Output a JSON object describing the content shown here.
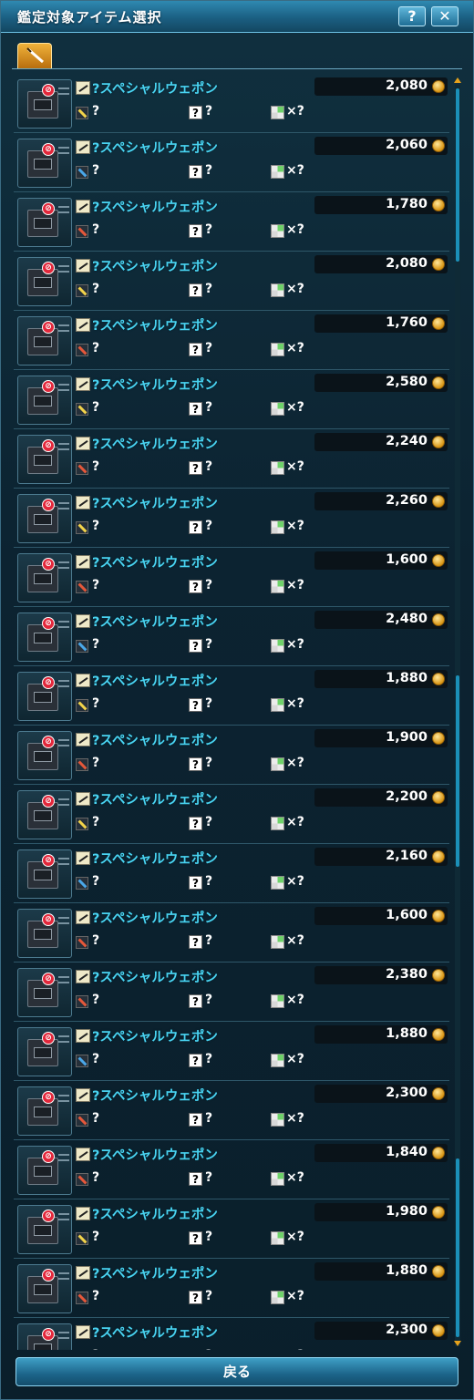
{
  "window": {
    "title": "鑑定対象アイテム選択",
    "help_label": "?",
    "close_label": "✕"
  },
  "icons": {
    "tab": "sword-icon",
    "row_thumb": "box-icon",
    "restricted": "ban-icon",
    "weapon": "weapon-icon",
    "category": "weapon-category-icon",
    "unknown": "question-icon",
    "lock": "lock-icon",
    "currency": "meseta-coin-icon"
  },
  "items": [
    {
      "name": "?スペシャルウェポン",
      "price": "2,080",
      "attr": "?",
      "unknown": "?",
      "multiplier": "×?"
    },
    {
      "name": "?スペシャルウェポン",
      "price": "2,060",
      "attr": "?",
      "unknown": "?",
      "multiplier": "×?"
    },
    {
      "name": "?スペシャルウェポン",
      "price": "1,780",
      "attr": "?",
      "unknown": "?",
      "multiplier": "×?"
    },
    {
      "name": "?スペシャルウェポン",
      "price": "2,080",
      "attr": "?",
      "unknown": "?",
      "multiplier": "×?"
    },
    {
      "name": "?スペシャルウェポン",
      "price": "1,760",
      "attr": "?",
      "unknown": "?",
      "multiplier": "×?"
    },
    {
      "name": "?スペシャルウェポン",
      "price": "2,580",
      "attr": "?",
      "unknown": "?",
      "multiplier": "×?"
    },
    {
      "name": "?スペシャルウェポン",
      "price": "2,240",
      "attr": "?",
      "unknown": "?",
      "multiplier": "×?"
    },
    {
      "name": "?スペシャルウェポン",
      "price": "2,260",
      "attr": "?",
      "unknown": "?",
      "multiplier": "×?"
    },
    {
      "name": "?スペシャルウェポン",
      "price": "1,600",
      "attr": "?",
      "unknown": "?",
      "multiplier": "×?"
    },
    {
      "name": "?スペシャルウェポン",
      "price": "2,480",
      "attr": "?",
      "unknown": "?",
      "multiplier": "×?"
    },
    {
      "name": "?スペシャルウェポン",
      "price": "1,880",
      "attr": "?",
      "unknown": "?",
      "multiplier": "×?"
    },
    {
      "name": "?スペシャルウェポン",
      "price": "1,900",
      "attr": "?",
      "unknown": "?",
      "multiplier": "×?"
    },
    {
      "name": "?スペシャルウェポン",
      "price": "2,200",
      "attr": "?",
      "unknown": "?",
      "multiplier": "×?"
    },
    {
      "name": "?スペシャルウェポン",
      "price": "2,160",
      "attr": "?",
      "unknown": "?",
      "multiplier": "×?"
    },
    {
      "name": "?スペシャルウェポン",
      "price": "1,600",
      "attr": "?",
      "unknown": "?",
      "multiplier": "×?"
    },
    {
      "name": "?スペシャルウェポン",
      "price": "2,380",
      "attr": "?",
      "unknown": "?",
      "multiplier": "×?"
    },
    {
      "name": "?スペシャルウェポン",
      "price": "1,880",
      "attr": "?",
      "unknown": "?",
      "multiplier": "×?"
    },
    {
      "name": "?スペシャルウェポン",
      "price": "2,300",
      "attr": "?",
      "unknown": "?",
      "multiplier": "×?"
    },
    {
      "name": "?スペシャルウェポン",
      "price": "1,840",
      "attr": "?",
      "unknown": "?",
      "multiplier": "×?"
    },
    {
      "name": "?スペシャルウェポン",
      "price": "1,980",
      "attr": "?",
      "unknown": "?",
      "multiplier": "×?"
    },
    {
      "name": "?スペシャルウェポン",
      "price": "1,880",
      "attr": "?",
      "unknown": "?",
      "multiplier": "×?"
    },
    {
      "name": "?スペシャルウェポン",
      "price": "2,300",
      "attr": "?",
      "unknown": "?",
      "multiplier": "×?"
    }
  ],
  "footer": {
    "back_label": "戻る"
  },
  "colors": {
    "accent_text": "#49d4f2",
    "title_bar": "#1b5f82",
    "tab_active": "#e6a21c"
  }
}
